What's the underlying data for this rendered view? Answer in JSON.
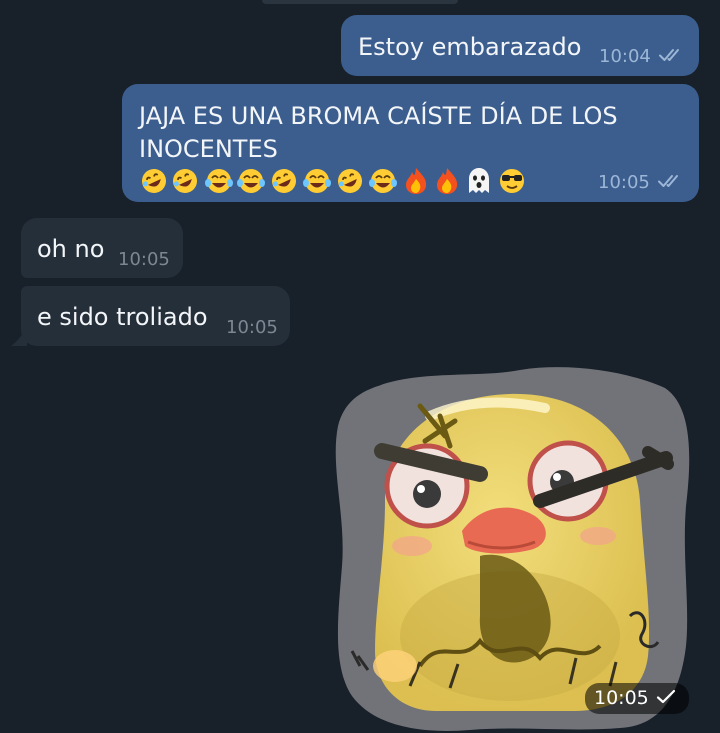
{
  "chat": {
    "messages": [
      {
        "direction": "outgoing",
        "text": "Estoy embarazado",
        "time": "10:04",
        "status": "read-double-check-icon"
      },
      {
        "direction": "outgoing",
        "text_line1": "JAJA ES UNA BROMA CAÍSTE DÍA DE LOS",
        "text_line2": "INOCENTES",
        "emojis": [
          "rolling-on-floor-laughing",
          "rolling-on-floor-laughing",
          "tears-of-joy",
          "tears-of-joy",
          "rolling-on-floor-laughing",
          "tears-of-joy",
          "rolling-on-floor-laughing",
          "tears-of-joy",
          "fire",
          "fire",
          "ghost",
          "sunglasses-face"
        ],
        "time": "10:05",
        "status": "read-double-check-icon"
      },
      {
        "direction": "incoming",
        "text": "oh no",
        "time": "10:05"
      },
      {
        "direction": "incoming",
        "text": "e sido troliado",
        "time": "10:05"
      },
      {
        "direction": "outgoing",
        "type": "sticker",
        "sticker": "angry-yellow-chick-sticker",
        "time": "10:05",
        "status": "sent-single-check-icon"
      }
    ]
  },
  "colors": {
    "background": "#18202a",
    "outgoing_bubble": "#3c5e8f",
    "incoming_bubble": "#252f3a",
    "read_check": "#9db6d6"
  }
}
